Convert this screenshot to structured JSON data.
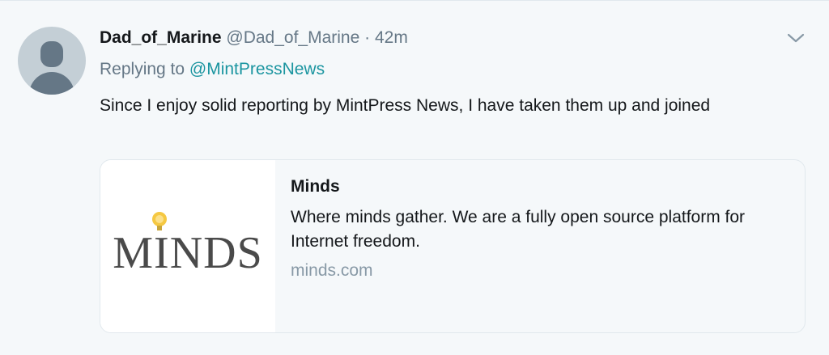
{
  "tweet": {
    "display_name": "Dad_of_Marine",
    "handle": "@Dad_of_Marine",
    "separator": "·",
    "timestamp": "42m",
    "reply_prefix": "Replying to",
    "reply_to": "@MintPressNews",
    "text": "Since I enjoy solid reporting by MintPress News, I have taken them up and joined",
    "more_icon": "chevron-down-icon",
    "avatar_icon": "default-avatar-icon"
  },
  "card": {
    "logo_text": "MINDS",
    "title": "Minds",
    "description": "Where minds gather. We are a fully open source platform for Internet freedom.",
    "domain": "minds.com"
  },
  "colors": {
    "link": "#1b95a0",
    "secondary_text": "#657786",
    "primary_text": "#14171a",
    "background": "#f5f8fa",
    "logo_bulb": "#f5c842"
  }
}
